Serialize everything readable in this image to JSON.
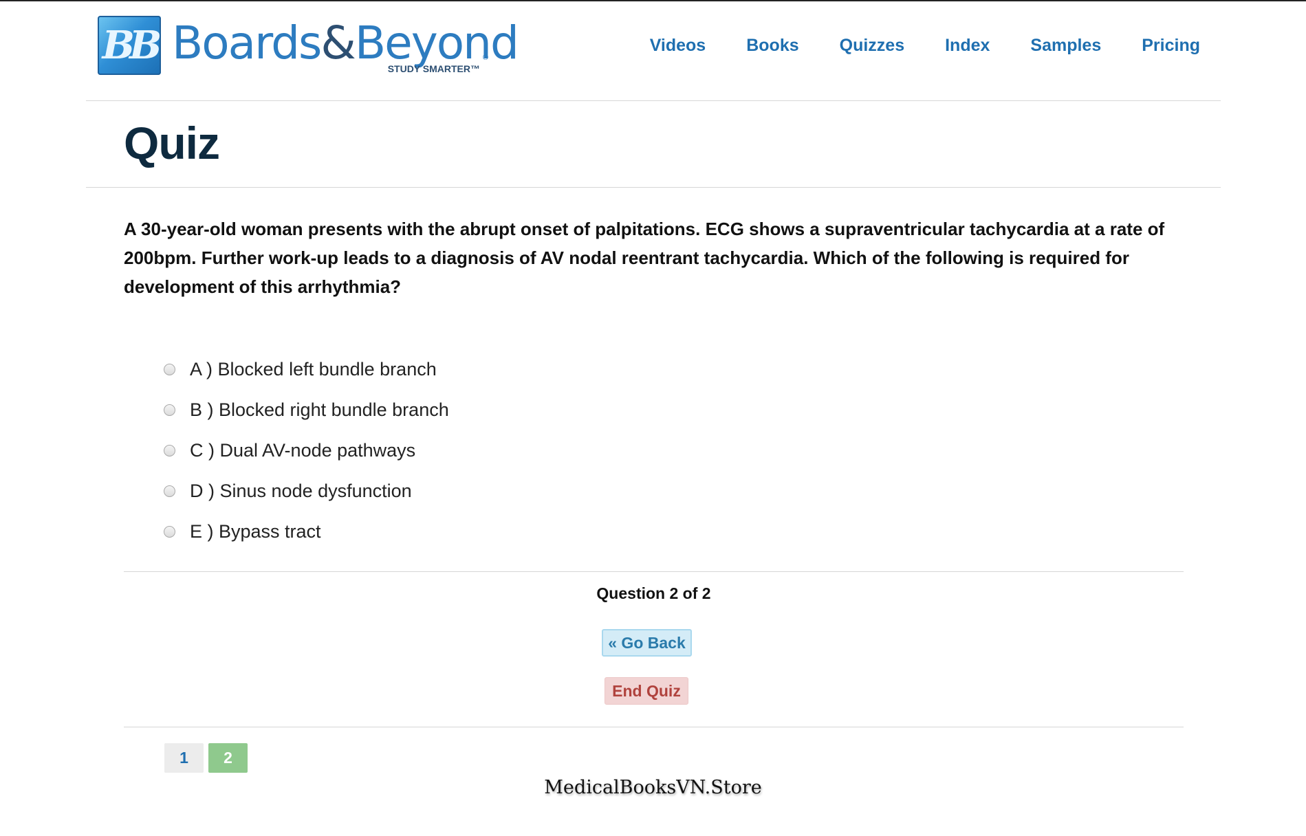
{
  "brand": {
    "badge": "BB",
    "name_part1": "Boards",
    "name_amp": "&",
    "name_part2": "Beyond",
    "tagline": "STUDY SMARTER™",
    "registered": "®"
  },
  "nav": {
    "items": [
      {
        "label": "Videos"
      },
      {
        "label": "Books"
      },
      {
        "label": "Quizzes"
      },
      {
        "label": "Index"
      },
      {
        "label": "Samples"
      },
      {
        "label": "Pricing"
      }
    ]
  },
  "page": {
    "title": "Quiz"
  },
  "quiz": {
    "question": "A 30-year-old woman presents with the abrupt onset of palpitations. ECG shows a supraventricular tachycardia at a rate of 200bpm. Further work-up leads to a diagnosis of AV nodal reentrant tachycardia. Which of the following is required for development of this arrhythmia?",
    "options": [
      {
        "label": "A ) Blocked left bundle branch"
      },
      {
        "label": "B ) Blocked right bundle branch"
      },
      {
        "label": "C ) Dual AV-node pathways"
      },
      {
        "label": "D ) Sinus node dysfunction"
      },
      {
        "label": "E ) Bypass tract"
      }
    ],
    "progress": "Question 2 of 2",
    "back_label": "« Go Back",
    "end_label": "End Quiz",
    "pages": [
      {
        "label": "1",
        "state": "inactive"
      },
      {
        "label": "2",
        "state": "active"
      }
    ]
  },
  "watermark": "MedicalBooksVN.Store",
  "colors": {
    "nav_link": "#1f6fb0",
    "title": "#0e2a3f",
    "back_button_bg": "#d4ecf7",
    "end_button_bg": "#f2d4d4",
    "active_page": "#8fc98d"
  }
}
